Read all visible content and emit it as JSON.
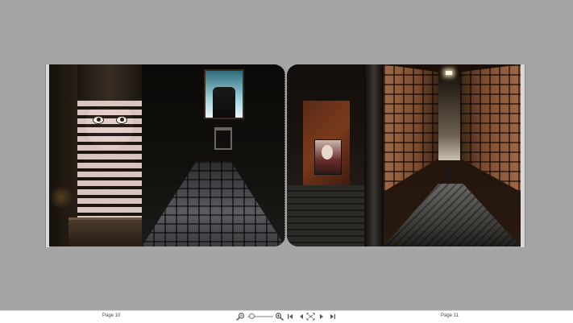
{
  "viewer": {
    "left_page_label": "Page 10",
    "right_page_label": "Page 11",
    "zoom_level_fraction": 0.08
  },
  "icons": {
    "zoom_out": "zoom-out-magnifier-icon",
    "zoom_in": "zoom-in-magnifier-icon",
    "first_page": "skip-first-icon",
    "prev_page": "triangle-left-icon",
    "fit_view": "fit-to-screen-icon",
    "next_page": "triangle-right-icon",
    "last_page": "skip-last-icon"
  },
  "colors": {
    "background": "#a5a5a5",
    "toolbar": "#ffffff",
    "icon": "#555555"
  }
}
